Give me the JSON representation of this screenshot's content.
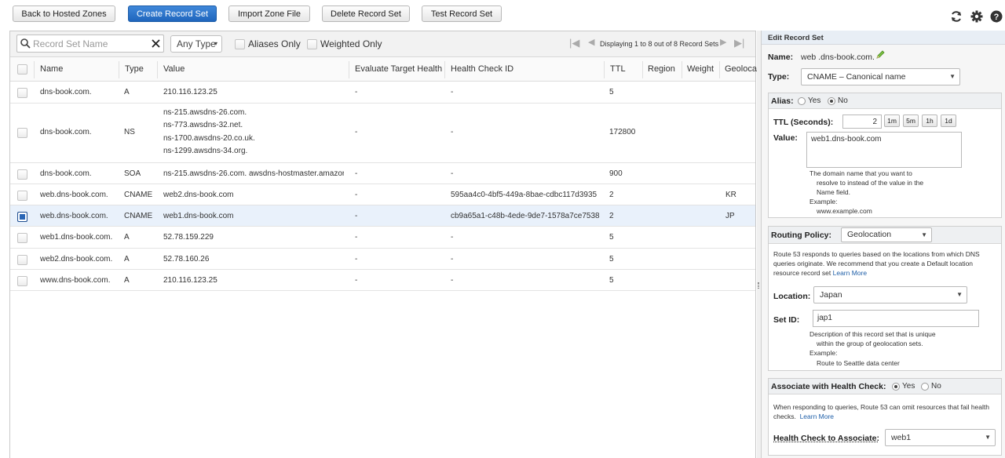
{
  "toolbar": {
    "back": "Back to Hosted Zones",
    "create": "Create Record Set",
    "import": "Import Zone File",
    "delete": "Delete Record Set",
    "test": "Test Record Set"
  },
  "filter": {
    "search_placeholder": "Record Set Name",
    "type": "Any Type",
    "aliases_only": "Aliases Only",
    "weighted_only": "Weighted Only",
    "paging": "Displaying 1 to 8 out of 8 Record Sets"
  },
  "columns": [
    "Name",
    "Type",
    "Value",
    "Evaluate Target Health",
    "Health Check ID",
    "TTL",
    "Region",
    "Weight",
    "Geoloca"
  ],
  "rows": [
    {
      "name": "dns-book.com.",
      "type": "A",
      "value": [
        "210.116.123.25"
      ],
      "eval": "-",
      "hc": "-",
      "ttl": "5",
      "geo": "",
      "selected": false
    },
    {
      "name": "dns-book.com.",
      "type": "NS",
      "value": [
        "ns-215.awsdns-26.com.",
        "ns-773.awsdns-32.net.",
        "ns-1700.awsdns-20.co.uk.",
        "ns-1299.awsdns-34.org."
      ],
      "eval": "-",
      "hc": "-",
      "ttl": "172800",
      "geo": "",
      "selected": false
    },
    {
      "name": "dns-book.com.",
      "type": "SOA",
      "value": [
        "ns-215.awsdns-26.com. awsdns-hostmaster.amazor"
      ],
      "eval": "-",
      "hc": "-",
      "ttl": "900",
      "geo": "",
      "selected": false
    },
    {
      "name": "web.dns-book.com.",
      "type": "CNAME",
      "value": [
        "web2.dns-book.com"
      ],
      "eval": "-",
      "hc": "595aa4c0-4bf5-449a-8bae-cdbc117d3935",
      "ttl": "2",
      "geo": "KR",
      "selected": false
    },
    {
      "name": "web.dns-book.com.",
      "type": "CNAME",
      "value": [
        "web1.dns-book.com"
      ],
      "eval": "-",
      "hc": "cb9a65a1-c48b-4ede-9de7-1578a7ce7538",
      "ttl": "2",
      "geo": "JP",
      "selected": true
    },
    {
      "name": "web1.dns-book.com.",
      "type": "A",
      "value": [
        "52.78.159.229"
      ],
      "eval": "-",
      "hc": "-",
      "ttl": "5",
      "geo": "",
      "selected": false
    },
    {
      "name": "web2.dns-book.com.",
      "type": "A",
      "value": [
        "52.78.160.26"
      ],
      "eval": "-",
      "hc": "-",
      "ttl": "5",
      "geo": "",
      "selected": false
    },
    {
      "name": "www.dns-book.com.",
      "type": "A",
      "value": [
        "210.116.123.25"
      ],
      "eval": "-",
      "hc": "-",
      "ttl": "5",
      "geo": "",
      "selected": false
    }
  ],
  "edit": {
    "title": "Edit Record Set",
    "name_label": "Name:",
    "name_value": "web .dns-book.com.",
    "type_label": "Type:",
    "type_value": "CNAME – Canonical name",
    "alias_label": "Alias:",
    "alias_yes": "Yes",
    "alias_no": "No",
    "ttl_label": "TTL (Seconds):",
    "ttl_value": "2",
    "ttl_buttons": [
      "1m",
      "5m",
      "1h",
      "1d"
    ],
    "value_label": "Value:",
    "value_text": "web1.dns-book.com",
    "value_help": [
      "The domain name that you want to",
      "resolve to instead of the value in the",
      "Name field.",
      "Example:",
      "www.example.com"
    ],
    "routing_label": "Routing Policy:",
    "routing_value": "Geolocation",
    "routing_desc": [
      "Route 53 responds to queries based on the locations from which DNS",
      "queries originate. We recommend that you create a Default location",
      "resource record set"
    ],
    "learn_more": "Learn More",
    "location_label": "Location:",
    "location_value": "Japan",
    "setid_label": "Set ID:",
    "setid_value": "jap1",
    "setid_help": [
      "Description of this record set that is unique",
      "within the group of geolocation sets.",
      "Example:",
      "Route to Seattle data center"
    ],
    "assoc_label": "Associate with Health Check:",
    "assoc_yes": "Yes",
    "assoc_no": "No",
    "assoc_desc": [
      "When responding to queries, Route 53 can omit resources that fail health",
      "checks."
    ],
    "hc_label": "Health Check to Associate:",
    "hc_value": "web1"
  }
}
